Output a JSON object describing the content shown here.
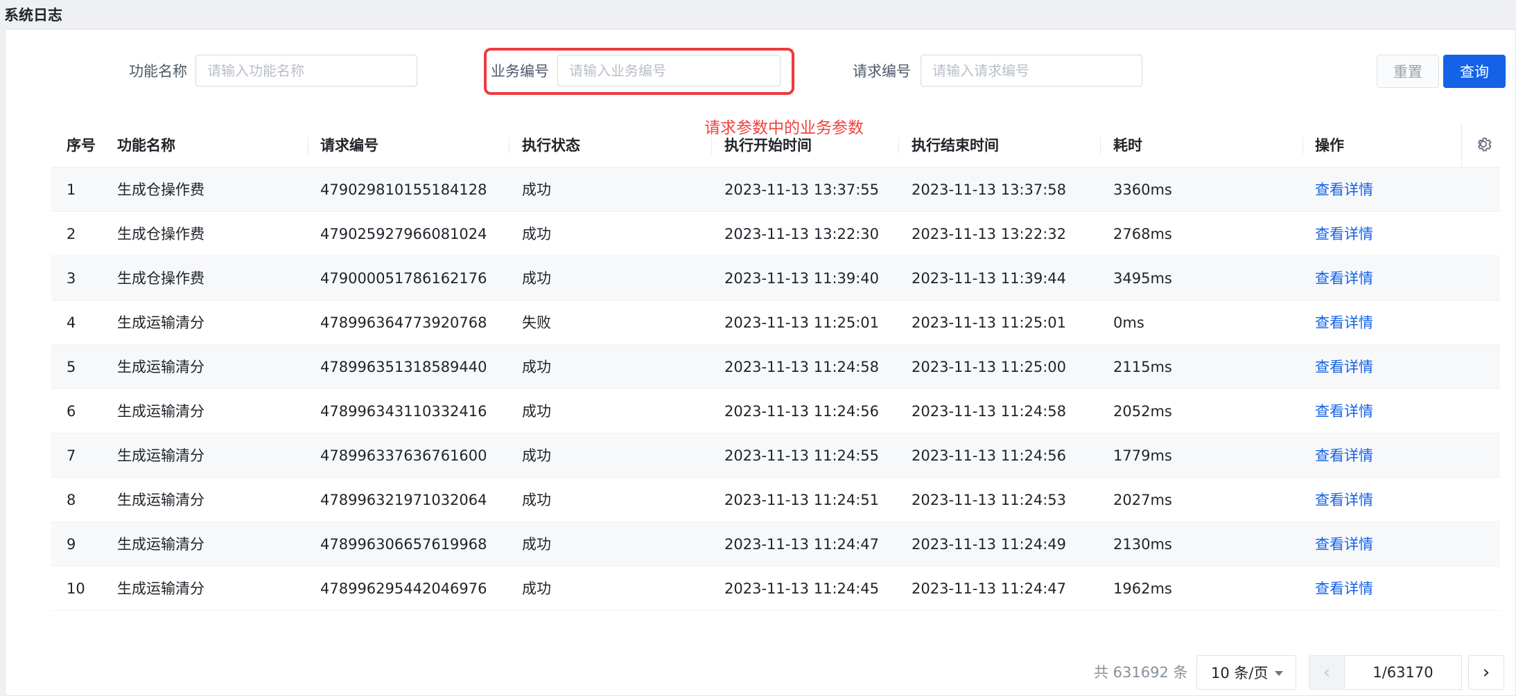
{
  "page": {
    "title": "系统日志"
  },
  "filters": {
    "func_name": {
      "label": "功能名称",
      "placeholder": "请输入功能名称",
      "value": ""
    },
    "biz_no": {
      "label": "业务编号",
      "placeholder": "请输入业务编号",
      "value": ""
    },
    "req_no": {
      "label": "请求编号",
      "placeholder": "请输入请求编号",
      "value": ""
    },
    "annotation": "请求参数中的业务参数",
    "highlight_color": "#ef3a3a"
  },
  "buttons": {
    "reset": "重置",
    "query": "查询"
  },
  "table": {
    "columns": [
      "序号",
      "功能名称",
      "请求编号",
      "执行状态",
      "执行开始时间",
      "执行结束时间",
      "耗时",
      "操作"
    ],
    "settings_icon": "gear-icon",
    "rows": [
      {
        "idx": "1",
        "name": "生成仓操作费",
        "req": "479029810155184128",
        "status": "成功",
        "start": "2023-11-13 13:37:55",
        "end": "2023-11-13 13:37:58",
        "cost": "3360ms",
        "action": "查看详情"
      },
      {
        "idx": "2",
        "name": "生成仓操作费",
        "req": "479025927966081024",
        "status": "成功",
        "start": "2023-11-13 13:22:30",
        "end": "2023-11-13 13:22:32",
        "cost": "2768ms",
        "action": "查看详情"
      },
      {
        "idx": "3",
        "name": "生成仓操作费",
        "req": "479000051786162176",
        "status": "成功",
        "start": "2023-11-13 11:39:40",
        "end": "2023-11-13 11:39:44",
        "cost": "3495ms",
        "action": "查看详情"
      },
      {
        "idx": "4",
        "name": "生成运输清分",
        "req": "478996364773920768",
        "status": "失败",
        "start": "2023-11-13 11:25:01",
        "end": "2023-11-13 11:25:01",
        "cost": "0ms",
        "action": "查看详情"
      },
      {
        "idx": "5",
        "name": "生成运输清分",
        "req": "478996351318589440",
        "status": "成功",
        "start": "2023-11-13 11:24:58",
        "end": "2023-11-13 11:25:00",
        "cost": "2115ms",
        "action": "查看详情"
      },
      {
        "idx": "6",
        "name": "生成运输清分",
        "req": "478996343110332416",
        "status": "成功",
        "start": "2023-11-13 11:24:56",
        "end": "2023-11-13 11:24:58",
        "cost": "2052ms",
        "action": "查看详情"
      },
      {
        "idx": "7",
        "name": "生成运输清分",
        "req": "478996337636761600",
        "status": "成功",
        "start": "2023-11-13 11:24:55",
        "end": "2023-11-13 11:24:56",
        "cost": "1779ms",
        "action": "查看详情"
      },
      {
        "idx": "8",
        "name": "生成运输清分",
        "req": "478996321971032064",
        "status": "成功",
        "start": "2023-11-13 11:24:51",
        "end": "2023-11-13 11:24:53",
        "cost": "2027ms",
        "action": "查看详情"
      },
      {
        "idx": "9",
        "name": "生成运输清分",
        "req": "478996306657619968",
        "status": "成功",
        "start": "2023-11-13 11:24:47",
        "end": "2023-11-13 11:24:49",
        "cost": "2130ms",
        "action": "查看详情"
      },
      {
        "idx": "10",
        "name": "生成运输清分",
        "req": "478996295442046976",
        "status": "成功",
        "start": "2023-11-13 11:24:45",
        "end": "2023-11-13 11:24:47",
        "cost": "1962ms",
        "action": "查看详情"
      }
    ]
  },
  "pagination": {
    "total_text": "共 631692 条",
    "page_size": "10 条/页",
    "current": "1/63170"
  },
  "colors": {
    "primary": "#1463e6",
    "annotation": "#f04141"
  }
}
